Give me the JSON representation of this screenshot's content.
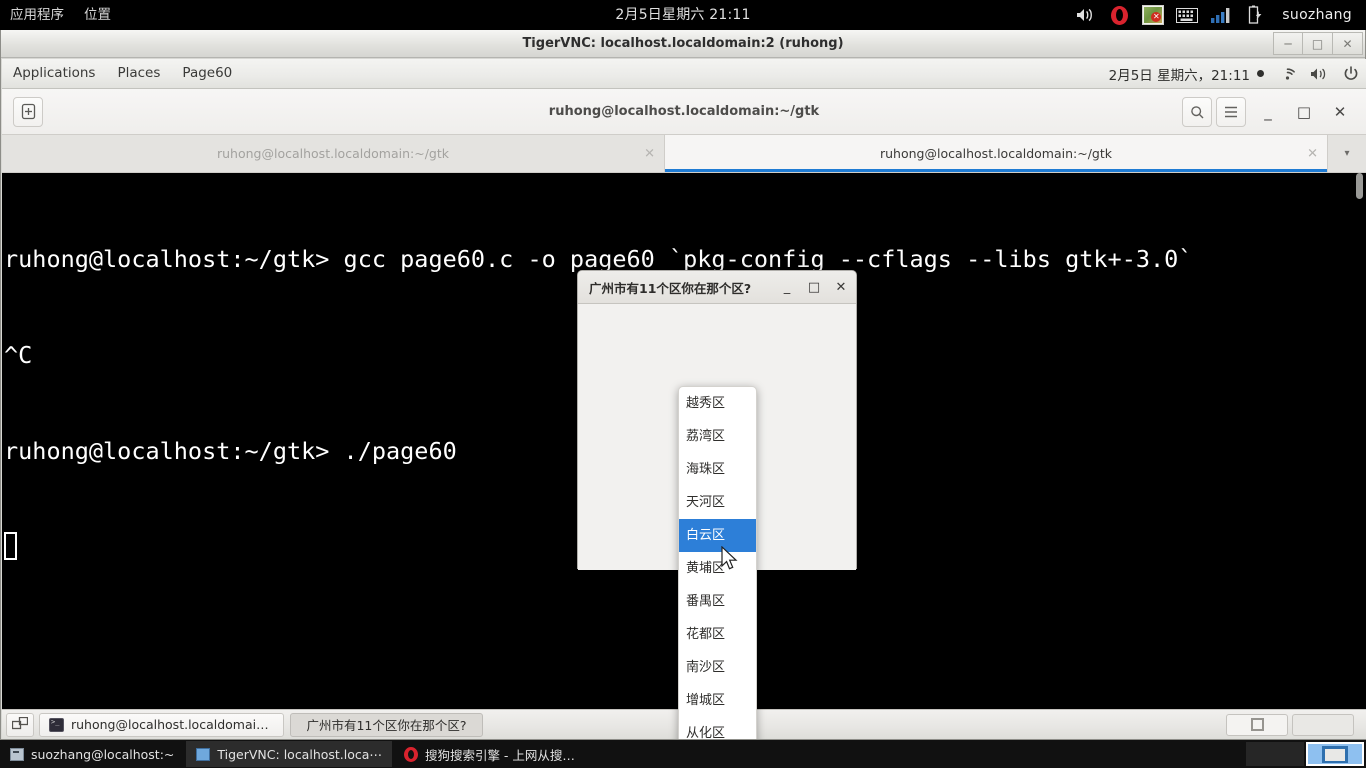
{
  "host_panel": {
    "menus": [
      "应用程序",
      "位置"
    ],
    "clock": "2月5日星期六 21:11",
    "tray": [
      {
        "name": "volume-icon",
        "glyph": "🔊"
      },
      {
        "name": "opera-icon",
        "glyph": ""
      },
      {
        "name": "package-update-icon",
        "glyph": ""
      },
      {
        "name": "keyboard-icon",
        "glyph": "⌨"
      },
      {
        "name": "network-signal-icon",
        "glyph": ""
      },
      {
        "name": "battery-icon",
        "glyph": ""
      }
    ],
    "user": "suozhang"
  },
  "vnc_window": {
    "title": "TigerVNC: localhost.localdomain:2 (ruhong)",
    "minimize": "─",
    "maximize": "□",
    "close": "✕"
  },
  "guest_panel": {
    "menus": [
      "Applications",
      "Places",
      "Page60"
    ],
    "clock": "2月5日 星期六，21:11",
    "icons": [
      "wifi-icon",
      "volume-icon",
      "power-icon"
    ]
  },
  "terminal": {
    "title": "ruhong@localhost.localdomain:~/gtk",
    "new_tab_label": "+",
    "search_label": "⌕",
    "menu_label": "≡",
    "minimize": "_",
    "maximize": "□",
    "close": "✕",
    "tab_list": "▾",
    "tabs": [
      {
        "label": "ruhong@localhost.localdomain:~/gtk",
        "active": false,
        "close": "✕"
      },
      {
        "label": "ruhong@localhost.localdomain:~/gtk",
        "active": true,
        "close": "✕"
      }
    ],
    "lines": [
      "ruhong@localhost:~/gtk> gcc page60.c -o page60 `pkg-config --cflags --libs gtk+-3.0`",
      "^C",
      "ruhong@localhost:~/gtk> ./page60"
    ]
  },
  "gtk_dialog": {
    "title": "广州市有11个区你在那个区?",
    "minimize": "_",
    "maximize": "□",
    "close": "✕"
  },
  "dropdown": {
    "selected": "白云区",
    "items": [
      {
        "label": "越秀区",
        "selected": false
      },
      {
        "label": "荔湾区",
        "selected": false
      },
      {
        "label": "海珠区",
        "selected": false
      },
      {
        "label": "天河区",
        "selected": false
      },
      {
        "label": "白云区",
        "selected": true
      },
      {
        "label": "黄埔区",
        "selected": false
      },
      {
        "label": "番禺区",
        "selected": false
      },
      {
        "label": "花都区",
        "selected": false
      },
      {
        "label": "南沙区",
        "selected": false
      },
      {
        "label": "增城区",
        "selected": false
      },
      {
        "label": "从化区",
        "selected": false
      }
    ],
    "highlight_color": "#2d7fd8"
  },
  "guest_taskbar": {
    "show_desktop": "show-desktop-icon",
    "items": [
      {
        "label": "ruhong@localhost.localdomain:~/…",
        "pressed": false,
        "icon": "terminal-icon"
      },
      {
        "label": "广州市有11个区你在那个区?",
        "pressed": true,
        "icon": ""
      }
    ],
    "workspaces": [
      {
        "active": true,
        "glyph": "□"
      },
      {
        "active": false,
        "glyph": ""
      }
    ]
  },
  "host_taskbar": {
    "items": [
      {
        "label": "suozhang@localhost:~",
        "active": false,
        "icon": "terminal-icon"
      },
      {
        "label": "TigerVNC: localhost.loca⋯",
        "active": true,
        "icon": "window-icon"
      },
      {
        "label": "搜狗搜索引擎 - 上网从搜…",
        "active": false,
        "icon": "opera-icon"
      }
    ],
    "workspaces": [
      {
        "active": false
      },
      {
        "active": true
      }
    ]
  }
}
